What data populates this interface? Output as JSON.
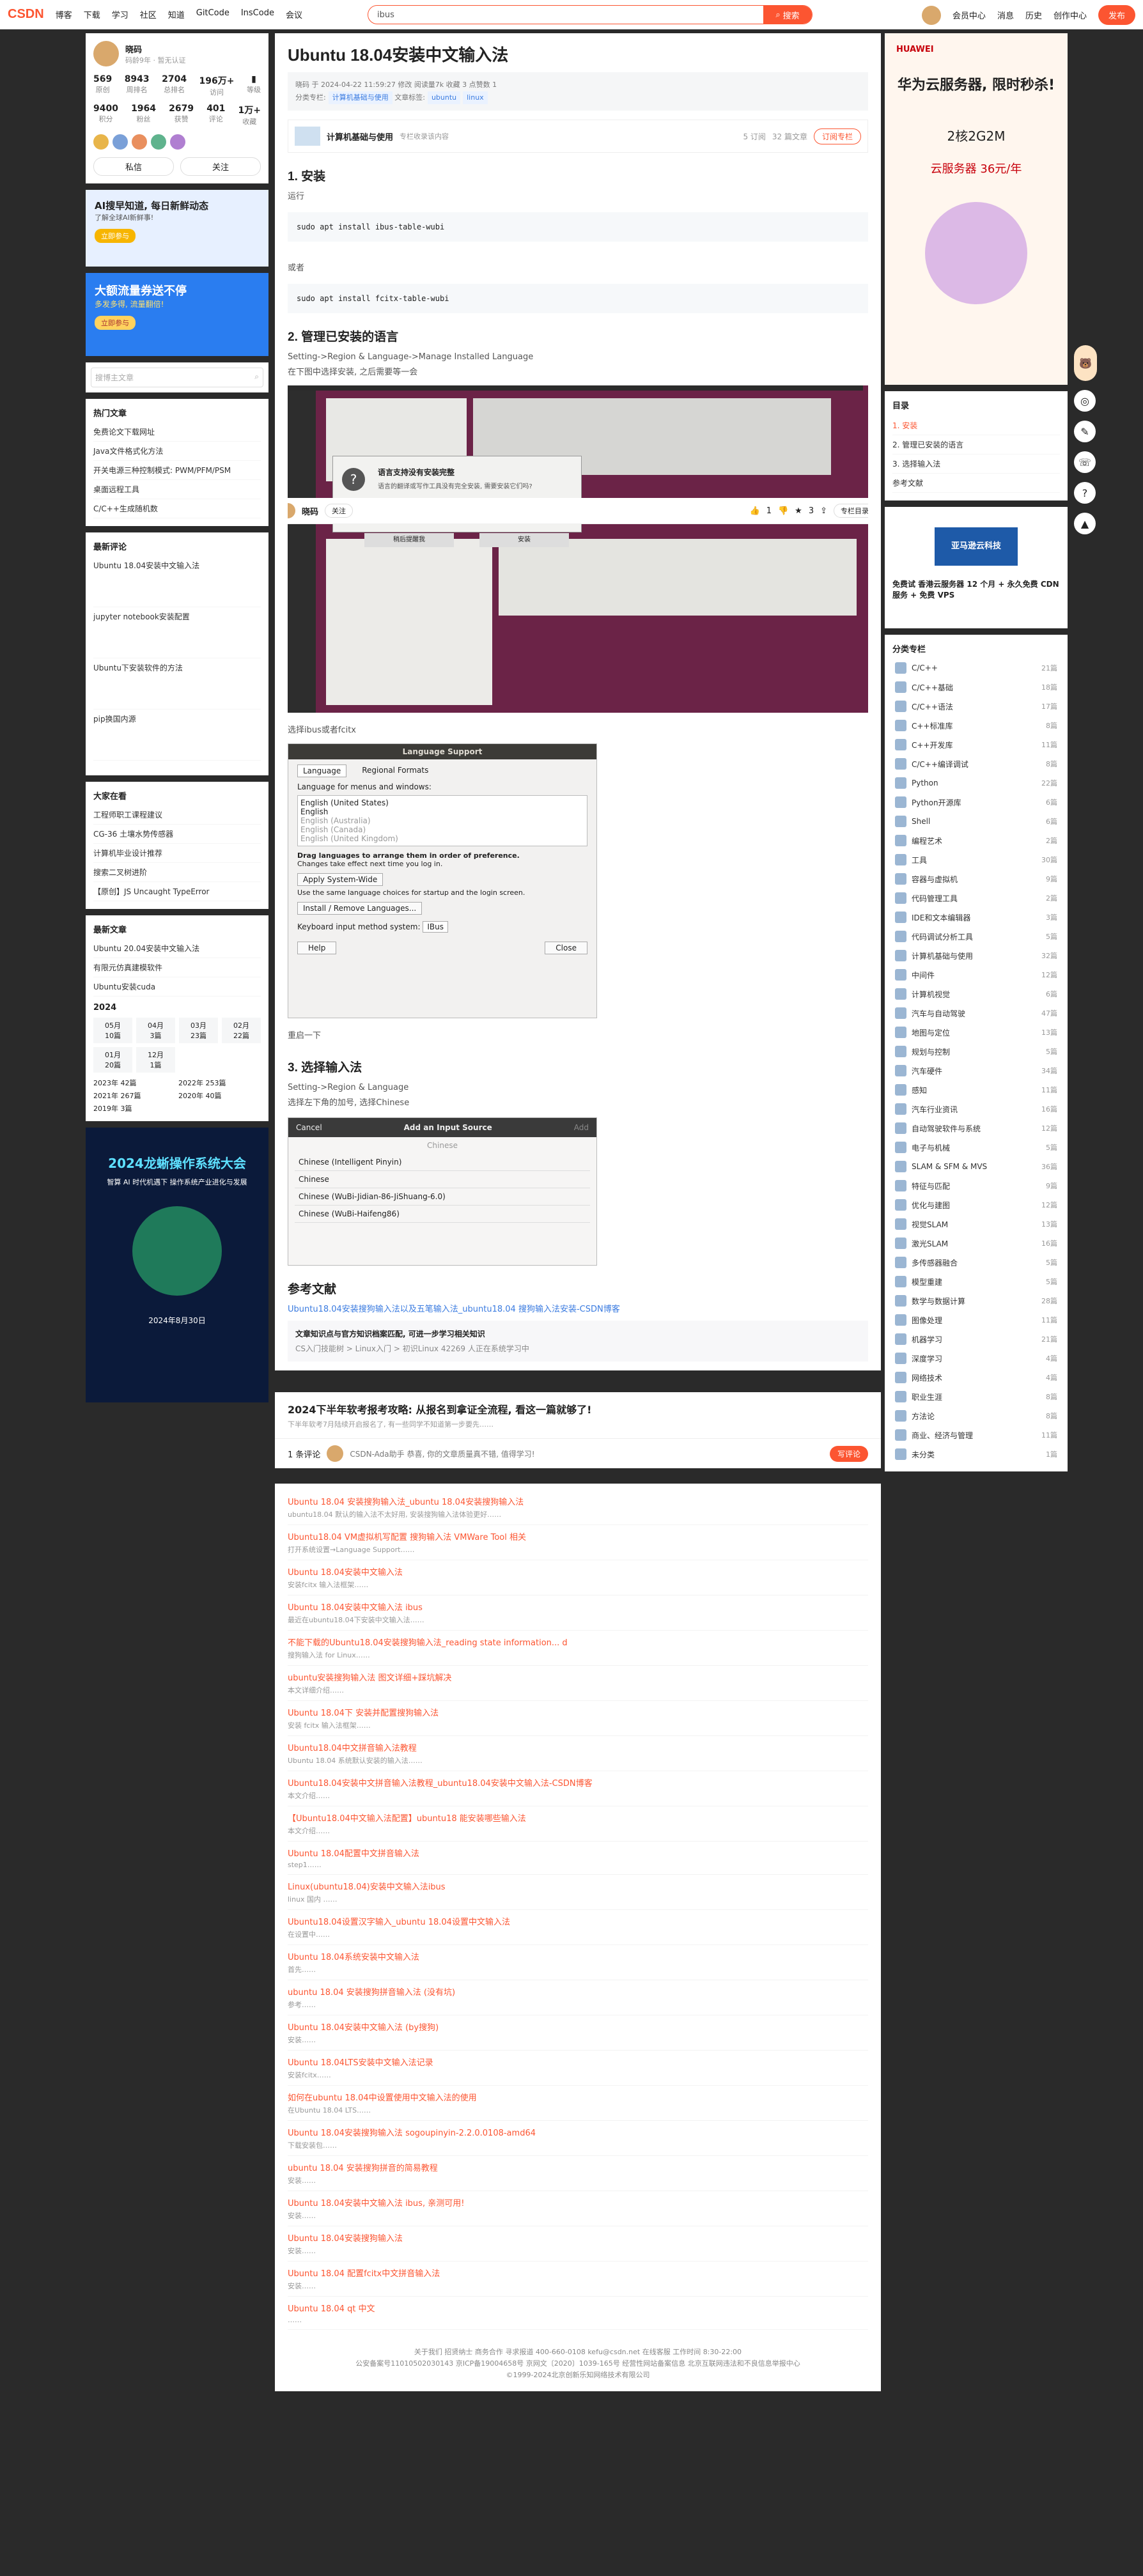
{
  "topbar": {
    "logo": "CSDN",
    "nav": [
      "博客",
      "下载",
      "学习",
      "社区",
      "知道",
      "GitCode",
      "InsCode",
      "会议"
    ],
    "search_value": "ibus",
    "search_btn": "搜索",
    "right": [
      "会员中心",
      "消息",
      "历史",
      "创作中心"
    ],
    "publish": "发布"
  },
  "author": {
    "name": "晓码",
    "badge": "码龄9年",
    "verify": "暂无认证",
    "stats": [
      [
        "569",
        "原创"
      ],
      [
        "8943",
        "周排名"
      ],
      [
        "2704",
        "总排名"
      ],
      [
        "196万+",
        "访问"
      ],
      [
        "",
        "等级"
      ]
    ],
    "stats2": [
      [
        "9400",
        "积分"
      ],
      [
        "1964",
        "粉丝"
      ],
      [
        "2679",
        "获赞"
      ],
      [
        "401",
        "评论"
      ],
      [
        "1万+",
        "收藏"
      ]
    ],
    "msg": "私信",
    "follow": "关注"
  },
  "ads_left": [
    {
      "title": "AI搜早知道, 每日新鲜动态",
      "sub": "了解全球AI新鲜事!",
      "btn": "立即参与"
    },
    {
      "title": "大额流量券送不停",
      "sub": "多发多得, 流量翻倍!",
      "btn": "立即参与"
    }
  ],
  "search_blog_placeholder": "搜博主文章",
  "hot": {
    "title": "热门文章",
    "items": [
      "免费论文下载网址",
      "Java文件格式化方法",
      "开关电源三种控制模式: PWM/PFM/PSM",
      "桌面远程工具",
      "C/C++生成随机数"
    ]
  },
  "newcomments": {
    "title": "最新评论",
    "items": [
      "Ubuntu 18.04安装中文输入法",
      "jupyter notebook安装配置",
      "Ubuntu下安装软件的方法",
      "pip换国内源"
    ]
  },
  "recommend": {
    "title": "大家在看",
    "items": [
      "工程师职工课程建议",
      "CG-36 土壤水势传感器",
      "计算机毕业设计推荐",
      "搜索二叉树进阶",
      "【原创】JS Uncaught TypeError"
    ]
  },
  "recent": {
    "title": "最新文章",
    "items": [
      "Ubuntu 20.04安装中文输入法",
      "有限元仿真建模软件",
      "Ubuntu安装cuda"
    ]
  },
  "archive": {
    "year": "2024",
    "months": [
      [
        "05月",
        "10篇"
      ],
      [
        "04月",
        "3篇"
      ],
      [
        "03月",
        "23篇"
      ],
      [
        "02月",
        "22篇"
      ],
      [
        "01月",
        "20篇"
      ],
      [
        "12月",
        "1篇"
      ]
    ],
    "years": [
      [
        "2023年",
        "42篇"
      ],
      [
        "2022年",
        "253篇"
      ],
      [
        "2021年",
        "267篇"
      ],
      [
        "2020年",
        "40篇"
      ],
      [
        "2019年",
        "3篇"
      ]
    ]
  },
  "bigad": {
    "title": "2024龙蜥操作系统大会",
    "sub": "智算 AI 时代机遇下 操作系统产业进化与发展",
    "date": "2024年8月30日"
  },
  "article": {
    "title": "Ubuntu 18.04安装中文输入法",
    "meta": "晓码  于 2024-04-22 11:59:27 修改  阅读量7k  收藏 3  点赞数 1",
    "cat_label": "分类专栏:",
    "cat": "计算机基础与使用",
    "tag_label": "文章标签:",
    "tags": [
      "ubuntu",
      "linux"
    ],
    "column": "计算机基础与使用",
    "column_desc": "专栏收录该内容",
    "column_count": "5 订阅",
    "column_articles": "32 篇文章",
    "subscribe": "订阅专栏",
    "h_install": "1. 安装",
    "run": "运行",
    "code1": "sudo apt install ibus-table-wubi",
    "or": "或者",
    "code2": "sudo apt install fcitx-table-wubi",
    "h_manage": "2. 管理已安装的语言",
    "manage_path": "Setting->Region & Language->Manage Installed Language",
    "manage_desc": "在下图中选择安装, 之后需要等一会",
    "sel_ibus": "选择ibus或者fcitx",
    "restart": "重启一下",
    "h_select": "3. 选择输入法",
    "select_path": "Setting->Region & Language",
    "select_desc": "选择左下角的加号, 选择Chinese",
    "ref_h": "参考文献",
    "ref_link": "Ubuntu18.04安装搜狗输入法以及五笔输入法_ubuntu18.04 搜狗输入法安装-CSDN博客",
    "knowledge": "文章知识点与官方知识档案匹配, 可进一步学习相关知识",
    "knowledge_sub": "CS入门技能树 > Linux入门 > 初识Linux    42269 人正在系统学习中"
  },
  "dialog1": {
    "title": "语言支持没有安装完整",
    "text": "语言的翻译或写作工具没有完全安装, 需要安装它们吗?",
    "btn1": "稍后提醒我",
    "btn2": "安装"
  },
  "langsupport": {
    "title": "Language Support",
    "tabs": [
      "Language",
      "Regional Formats"
    ],
    "label": "Language for menus and windows:",
    "langs": [
      "English (United States)",
      "English",
      "English (Australia)",
      "English (Canada)",
      "English (United Kingdom)"
    ],
    "drag": "Drag languages to arrange them in order of preference.",
    "drag2": "Changes take effect next time you log in.",
    "apply": "Apply System-Wide",
    "apply_desc": "Use the same language choices for startup and the login screen.",
    "install": "Install / Remove Languages...",
    "kb": "Keyboard input method system:",
    "kb_val": "IBus",
    "help": "Help",
    "close": "Close"
  },
  "inputsrc": {
    "cancel": "Cancel",
    "title": "Add an Input Source",
    "add": "Add",
    "search": "Chinese",
    "items": [
      "Chinese (Intelligent Pinyin)",
      "Chinese",
      "Chinese (WuBi-Jidian-86-JiShuang-6.0)",
      "Chinese (WuBi-Haifeng86)"
    ]
  },
  "floatbar": {
    "author": "晓码",
    "follow": "关注",
    "likes": "1",
    "stars": "3",
    "col": "专栏目录"
  },
  "campaign": {
    "title": "2024下半年软考报考攻略: 从报名到拿证全流程, 看这一篇就够了!",
    "desc": "下半年软考7月陆续开启报名了, 有一些同学不知道第一步要先……"
  },
  "comment": {
    "count": "1 条评论",
    "placeholder": "CSDN-Ada助手  恭喜, 你的文章质量真不错, 值得学习!",
    "btn": "写评论"
  },
  "related": [
    [
      "Ubuntu 18.04 安装搜狗输入法_ubuntu 18.04安装搜狗输入法",
      "ubuntu18.04 默认的输入法不太好用, 安装搜狗输入法体验更好……"
    ],
    [
      "Ubuntu18.04 VM虚拟机写配置 搜狗输入法 VMWare Tool 相关",
      "打开系统设置→Language Support……"
    ],
    [
      "Ubuntu 18.04安装中文输入法",
      "安装fcitx 输入法框架……"
    ],
    [
      "Ubuntu 18.04安装中文输入法 ibus",
      "最近在ubuntu18.04下安装中文输入法……"
    ],
    [
      "不能下载的Ubuntu18.04安装搜狗输入法_reading state information... d",
      "搜狗输入法 for Linux……"
    ],
    [
      "ubuntu安装搜狗输入法 图文详细+踩坑解决",
      "本文详细介绍……"
    ],
    [
      "Ubuntu 18.04下 安装并配置搜狗输入法",
      "安装 fcitx 输入法框架……"
    ],
    [
      "Ubuntu18.04中文拼音输入法教程",
      "Ubuntu 18.04 系统默认安装的输入法……"
    ],
    [
      "Ubuntu18.04安装中文拼音输入法教程_ubuntu18.04安装中文输入法-CSDN博客",
      "本文介绍……"
    ],
    [
      "【Ubuntu18.04中文输入法配置】ubuntu18 能安装哪些输入法",
      "本文介绍……"
    ],
    [
      "Ubuntu 18.04配置中文拼音输入法",
      "step1……"
    ],
    [
      "Linux(ubuntu18.04)安装中文输入法ibus",
      "linux 国内 ……"
    ],
    [
      "Ubuntu18.04设置汉字输入_ubuntu 18.04设置中文输入法",
      "在设置中……"
    ],
    [
      "Ubuntu 18.04系统安装中文输入法",
      "首先……"
    ],
    [
      "ubuntu 18.04 安装搜狗拼音输入法 (没有坑)",
      "参考……"
    ],
    [
      "Ubuntu 18.04安装中文输入法 (by搜狗)",
      "安装……"
    ],
    [
      "Ubuntu 18.04LTS安装中文输入法记录",
      "安装fcitx……"
    ],
    [
      "如何在ubuntu 18.04中设置使用中文输入法的使用",
      "在Ubuntu 18.04 LTS……"
    ],
    [
      "Ubuntu 18.04安装搜狗输入法 sogoupinyin-2.2.0.0108-amd64",
      "下载安装包……"
    ],
    [
      "ubuntu 18.04 安装搜狗拼音的简易教程",
      "安装……"
    ],
    [
      "Ubuntu 18.04安装中文输入法 ibus, 亲测可用!",
      "安装……"
    ],
    [
      "Ubuntu 18.04安装搜狗输入法",
      "安装……"
    ],
    [
      "Ubuntu 18.04 配置fcitx中文拼音输入法",
      "安装……"
    ],
    [
      "Ubuntu 18.04 qt 中文",
      "……"
    ]
  ],
  "footer": {
    "l1": "关于我们  招贤纳士  商务合作  寻求报道  400-660-0108  kefu@csdn.net  在线客服  工作时间 8:30-22:00",
    "l2": "公安备案号11010502030143  京ICP备19004658号  京网文〔2020〕1039-165号  经营性网站备案信息  北京互联网违法和不良信息举报中心",
    "l3": "©1999-2024北京创新乐知网络技术有限公司"
  },
  "right": {
    "ad1": "华为云服务器, 限时秒杀!",
    "ad1_spec": "2核2G2M",
    "ad1_price": "云服务器 36元/年",
    "toc_title": "目录",
    "toc": [
      "1. 安装",
      "2. 管理已安装的语言",
      "3. 选择输入法",
      "参考文献"
    ],
    "ad2": "亚马逊云科技",
    "ad2_desc": "免费试 香港云服务器 12 个月 + 永久免费 CDN 服务 + 免费 VPS",
    "cat_title": "分类专栏",
    "cats": [
      [
        "C/C++",
        "21篇"
      ],
      [
        "C/C++基础",
        "18篇"
      ],
      [
        "C/C++语法",
        "17篇"
      ],
      [
        "C++标准库",
        "8篇"
      ],
      [
        "C++开发库",
        "11篇"
      ],
      [
        "C/C++编译调试",
        "8篇"
      ],
      [
        "Python",
        "22篇"
      ],
      [
        "Python开源库",
        "6篇"
      ],
      [
        "Shell",
        "6篇"
      ],
      [
        "编程艺术",
        "2篇"
      ],
      [
        "工具",
        "30篇"
      ],
      [
        "容器与虚拟机",
        "9篇"
      ],
      [
        "代码管理工具",
        "2篇"
      ],
      [
        "IDE和文本编辑器",
        "3篇"
      ],
      [
        "代码调试分析工具",
        "5篇"
      ],
      [
        "计算机基础与使用",
        "32篇"
      ],
      [
        "中间件",
        "12篇"
      ],
      [
        "计算机视觉",
        "6篇"
      ],
      [
        "汽车与自动驾驶",
        "47篇"
      ],
      [
        "地图与定位",
        "13篇"
      ],
      [
        "规划与控制",
        "5篇"
      ],
      [
        "汽车硬件",
        "34篇"
      ],
      [
        "感知",
        "11篇"
      ],
      [
        "汽车行业资讯",
        "16篇"
      ],
      [
        "自动驾驶软件与系统",
        "12篇"
      ],
      [
        "电子与机械",
        "5篇"
      ],
      [
        "SLAM & SFM & MVS",
        "36篇"
      ],
      [
        "特征与匹配",
        "9篇"
      ],
      [
        "优化与建图",
        "12篇"
      ],
      [
        "视觉SLAM",
        "13篇"
      ],
      [
        "激光SLAM",
        "16篇"
      ],
      [
        "多传感器融合",
        "5篇"
      ],
      [
        "模型重建",
        "5篇"
      ],
      [
        "数学与数据计算",
        "28篇"
      ],
      [
        "图像处理",
        "11篇"
      ],
      [
        "机器学习",
        "21篇"
      ],
      [
        "深度学习",
        "4篇"
      ],
      [
        "网络技术",
        "4篇"
      ],
      [
        "职业生涯",
        "8篇"
      ],
      [
        "方法论",
        "8篇"
      ],
      [
        "商业、经济与管理",
        "11篇"
      ],
      [
        "未分类",
        "1篇"
      ]
    ]
  }
}
